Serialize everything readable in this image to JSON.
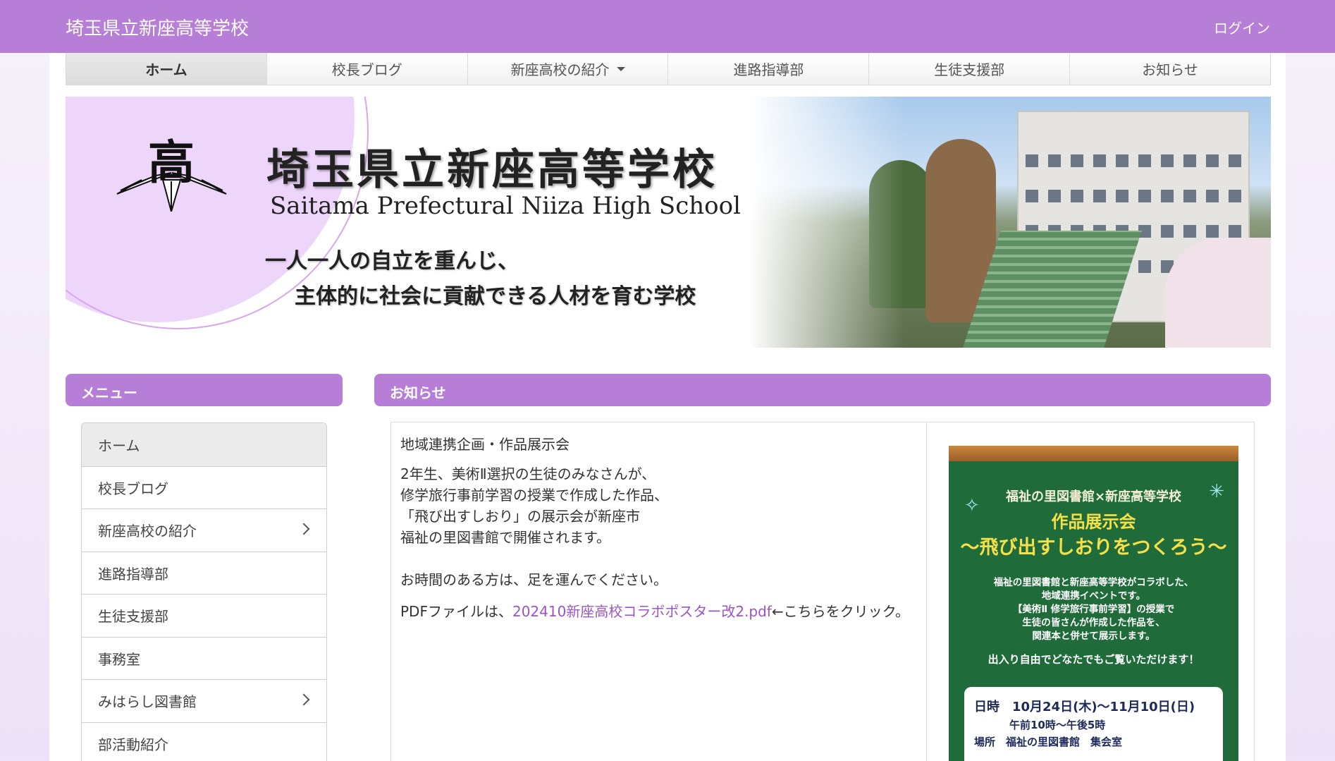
{
  "header": {
    "site_title": "埼玉県立新座高等学校",
    "login_label": "ログイン"
  },
  "navbar": {
    "items": [
      {
        "label": "ホーム"
      },
      {
        "label": "校長ブログ"
      },
      {
        "label": "新座高校の紹介"
      },
      {
        "label": "進路指導部"
      },
      {
        "label": "生徒支援部"
      },
      {
        "label": "お知らせ"
      }
    ]
  },
  "banner": {
    "emblem_char": "高",
    "title_ja": "埼玉県立新座高等学校",
    "title_en": "Saitama Prefectural Niiza High School",
    "motto_line1": "一人一人の自立を重んじ、",
    "motto_line2": "主体的に社会に貢献できる人材を育む学校"
  },
  "sidebar": {
    "heading": "メニュー",
    "items": [
      {
        "label": "ホーム"
      },
      {
        "label": "校長ブログ"
      },
      {
        "label": "新座高校の紹介"
      },
      {
        "label": "進路指導部"
      },
      {
        "label": "生徒支援部"
      },
      {
        "label": "事務室"
      },
      {
        "label": "みはらし図書館"
      },
      {
        "label": "部活動紹介"
      }
    ]
  },
  "news": {
    "heading": "お知らせ",
    "title": "地域連携企画・作品展示会",
    "body_lines": [
      "2年生、美術Ⅱ選択の生徒のみなさんが、",
      "修学旅行事前学習の授業で作成した作品、",
      "「飛び出すしおり」の展示会が新座市",
      "福祉の里図書館で開催されます。"
    ],
    "closing": "お時間のある方は、足を運んでください。",
    "pdf_prefix": "PDFファイルは、",
    "pdf_link": "202410新座高校コラボポスター改2.pdf",
    "pdf_suffix": "←こちらをクリック。"
  },
  "poster": {
    "line1": "福祉の里図書館×新座高等学校",
    "line2": "作品展示会",
    "line3": "〜飛び出すしおりをつくろう〜",
    "desc": [
      "福祉の里図書館と新座高等学校がコラボした、",
      "地域連携イベントです。",
      "【美術Ⅱ 修学旅行事前学習】の授業で",
      "生徒の皆さんが作成した作品を、",
      "関連本と併せて展示します。"
    ],
    "note": "出入り自由でどなたでもご覧いただけます！",
    "date_line": "日時　10月24日(木)〜11月10日(日)",
    "time_line": "午前10時〜午後5時",
    "place_line": "場所　福祉の里図書館　集会室"
  },
  "colors": {
    "accent": "#b67ed6",
    "link": "#9a55c2"
  }
}
